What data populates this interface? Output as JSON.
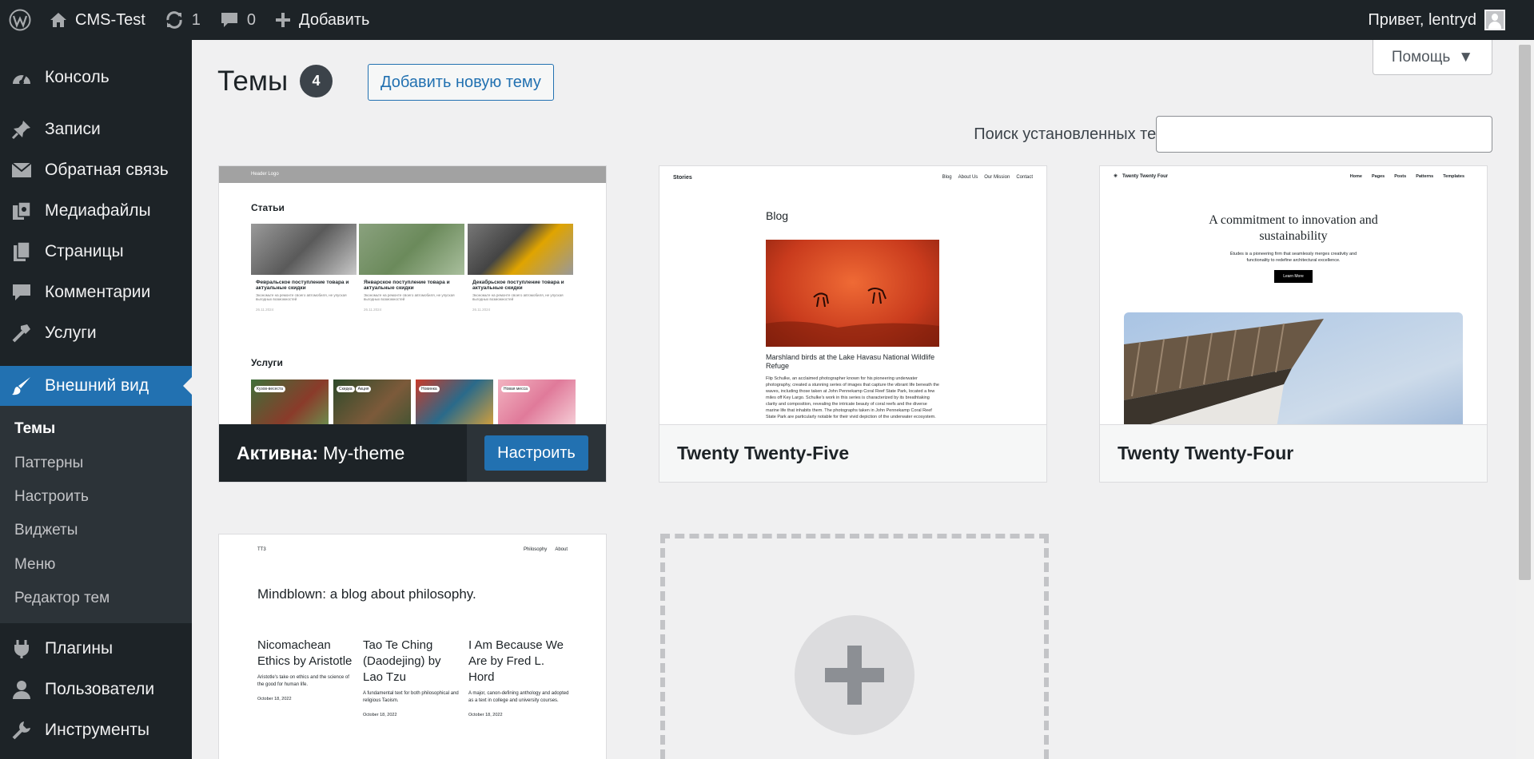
{
  "admin_bar": {
    "site_name": "CMS-Test",
    "updates": "1",
    "comments": "0",
    "new": "Добавить",
    "greeting": "Привет, lentryd"
  },
  "sidebar": {
    "items": [
      {
        "label": "Консоль",
        "icon": "dashboard-icon"
      },
      {
        "label": "Записи",
        "icon": "pin-icon"
      },
      {
        "label": "Обратная связь",
        "icon": "mail-icon"
      },
      {
        "label": "Медиафайлы",
        "icon": "media-icon"
      },
      {
        "label": "Страницы",
        "icon": "pages-icon"
      },
      {
        "label": "Комментарии",
        "icon": "comment-icon"
      },
      {
        "label": "Услуги",
        "icon": "hammer-icon"
      },
      {
        "label": "Внешний вид",
        "icon": "brush-icon"
      },
      {
        "label": "Плагины",
        "icon": "plugin-icon"
      },
      {
        "label": "Пользователи",
        "icon": "users-icon"
      },
      {
        "label": "Инструменты",
        "icon": "wrench-icon"
      }
    ],
    "submenu": [
      "Темы",
      "Паттерны",
      "Настроить",
      "Виджеты",
      "Меню",
      "Редактор тем"
    ]
  },
  "page": {
    "title": "Темы",
    "count": "4",
    "add_new": "Добавить новую тему",
    "help": "Помощь",
    "search_label": "Поиск установленных тем"
  },
  "themes": [
    {
      "active_label": "Активна:",
      "name": "My-theme",
      "customize": "Настроить",
      "preview": {
        "header": "Header Logo",
        "section1": "Статьи",
        "posts": [
          {
            "title": "Февральское поступление товара и актуальные скидки",
            "text": "Экономьте на ремонте своего автомобиля, не упуская выгодных возможностей",
            "date": "26.11.2024"
          },
          {
            "title": "Январское поступление товара и актуальные скидки",
            "text": "Экономьте на ремонте своего автомобиля, не упуская выгодных возможностей",
            "date": "26.11.2024"
          },
          {
            "title": "Декабрьское поступление товара и актуальные скидки",
            "text": "Экономьте на ремонте своего автомобиля, не упуская выгодных возможностей",
            "date": "26.11.2024"
          }
        ],
        "section2": "Услуги",
        "tags": [
          "Кузов-весеста",
          "Скидка",
          "Акция",
          "Новинка",
          "Новая месса"
        ]
      }
    },
    {
      "name": "Twenty Twenty-Five",
      "preview": {
        "site": "Stories",
        "nav": [
          "Blog",
          "About Us",
          "Our Mission",
          "Contact"
        ],
        "heading": "Blog",
        "post_title": "Marshland birds at the Lake Havasu National Wildlife Refuge",
        "post_text": "Flip Schulke, an acclaimed photographer known for his pioneering underwater photography, created a stunning series of images that capture the vibrant life beneath the waves, including those taken at John Pennekamp Coral Reef State Park, located a few miles off Key Largo. Schulke's work in this series is characterized by its breathtaking clarity and composition, revealing the intricate beauty of coral reefs and the diverse marine life that inhabits them. The photographs taken in John Pennekamp Coral Reef State Park are particularly notable for their vivid depiction of the underwater ecosystem."
      }
    },
    {
      "name": "Twenty Twenty-Four",
      "preview": {
        "site": "Twenty Twenty Four",
        "nav": [
          "Home",
          "Pages",
          "Posts",
          "Patterns",
          "Templates"
        ],
        "heading": "A commitment to innovation and sustainability",
        "sub": "Études is a pioneering firm that seamlessly merges creativity and functionality to redefine architectural excellence.",
        "button": "Learn More"
      }
    },
    {
      "name": "",
      "preview": {
        "site": "TT3",
        "nav": [
          "Philosophy",
          "About"
        ],
        "heading": "Mindblown: a blog about philosophy.",
        "posts": [
          {
            "title": "Nicomachean Ethics by Aristotle",
            "text": "Aristotle's take on ethics and the science of the good for human life.",
            "date": "October 18, 2022"
          },
          {
            "title": "Tao Te Ching (Daodejing) by Lao Tzu",
            "text": "A fundamental text for both philosophical and religious Taoism.",
            "date": "October 18, 2022"
          },
          {
            "title": "I Am Because We Are by Fred L. Hord",
            "text": "A major, canon-defining anthology and adopted as a text in college and university courses.",
            "date": "October 18, 2022"
          }
        ]
      }
    }
  ],
  "colors": {
    "admin_dark": "#1d2327",
    "accent": "#2271b1",
    "submenu_bg": "#2c3338",
    "page_bg": "#f0f0f1"
  }
}
